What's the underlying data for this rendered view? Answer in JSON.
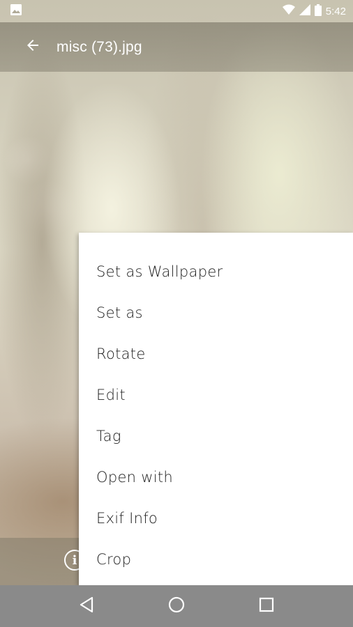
{
  "status_bar": {
    "time": "5:42",
    "icons": [
      "image-notification-icon",
      "wifi-icon",
      "signal-icon",
      "battery-icon"
    ]
  },
  "app_bar": {
    "title": "misc (73).jpg",
    "back_icon": "arrow-back-icon"
  },
  "overflow_menu": {
    "items": [
      {
        "label": "Set as Wallpaper"
      },
      {
        "label": "Set as"
      },
      {
        "label": "Rotate"
      },
      {
        "label": "Edit"
      },
      {
        "label": "Tag"
      },
      {
        "label": "Open with"
      },
      {
        "label": "Exif Info"
      },
      {
        "label": "Crop"
      }
    ]
  },
  "bottom_bar": {
    "info_icon": "info-icon"
  },
  "nav_bar": {
    "buttons": [
      "back-triangle-icon",
      "home-circle-icon",
      "recents-square-icon"
    ]
  },
  "colors": {
    "nav_bar": "#8a8a8a",
    "menu_bg": "#ffffff",
    "menu_text": "#222222"
  }
}
